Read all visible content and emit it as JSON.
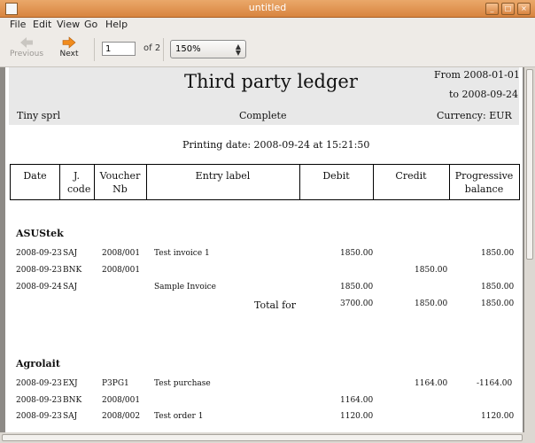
{
  "window": {
    "title": "untitled"
  },
  "menu": [
    "File",
    "Edit",
    "View",
    "Go",
    "Help"
  ],
  "toolbar": {
    "previous_label": "Previous",
    "next_label": "Next",
    "page_value": "1",
    "page_of": "of 2",
    "zoom_value": "150%"
  },
  "report": {
    "title": "Third party ledger",
    "from": "From 2008-01-01",
    "to": "to 2008-09-24",
    "company": "Tiny sprl",
    "status": "Complete",
    "currency": "Currency: EUR",
    "printing_date": "Printing date: 2008-09-24 at 15:21:50",
    "columns": [
      "Date",
      "J. code",
      "Voucher Nb",
      "Entry label",
      "Debit",
      "Credit",
      "Progressive balance"
    ],
    "total_label": "Total for",
    "groups": [
      {
        "name": "ASUStek",
        "rows": [
          {
            "date": "2008-09-23",
            "journal": "SAJ",
            "voucher": "2008/001",
            "label": "Test invoice 1",
            "debit": "1850.00",
            "credit": "",
            "balance": "1850.00"
          },
          {
            "date": "2008-09-23",
            "journal": "BNK",
            "voucher": "2008/001",
            "label": "",
            "debit": "",
            "credit": "1850.00",
            "balance": ""
          },
          {
            "date": "2008-09-24",
            "journal": "SAJ",
            "voucher": "",
            "label": "Sample Invoice",
            "debit": "1850.00",
            "credit": "",
            "balance": "1850.00"
          }
        ],
        "total": {
          "debit": "3700.00",
          "credit": "1850.00",
          "balance": "1850.00"
        }
      },
      {
        "name": "Agrolait",
        "rows": [
          {
            "date": "2008-09-23",
            "journal": "EXJ",
            "voucher": "P3PG1",
            "label": "Test purchase",
            "debit": "",
            "credit": "1164.00",
            "balance": "-1164.00"
          },
          {
            "date": "2008-09-23",
            "journal": "BNK",
            "voucher": "2008/001",
            "label": "",
            "debit": "1164.00",
            "credit": "",
            "balance": ""
          },
          {
            "date": "2008-09-23",
            "journal": "SAJ",
            "voucher": "2008/002",
            "label": "Test order 1",
            "debit": "1120.00",
            "credit": "",
            "balance": "1120.00"
          }
        ]
      }
    ]
  }
}
